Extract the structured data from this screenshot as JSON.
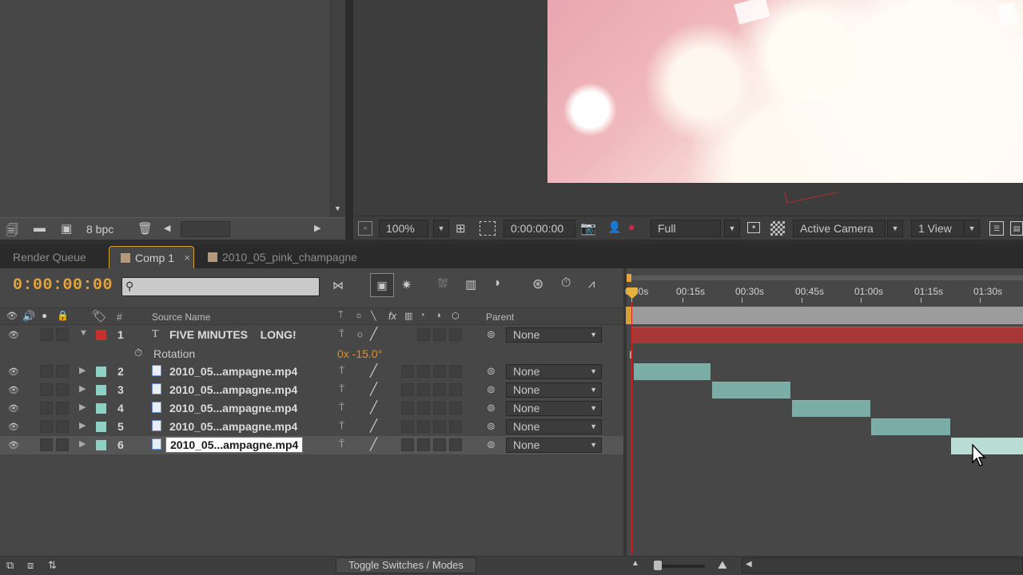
{
  "project": {
    "bpc_label": "8 bpc"
  },
  "viewer": {
    "zoom": "100%",
    "timecode": "0:00:00:00",
    "resolution": "Full",
    "camera": "Active Camera",
    "views": "1 View"
  },
  "tabs": {
    "render_queue": "Render Queue",
    "comp": "Comp 1",
    "comp_close": "×",
    "footage": "2010_05_pink_champagne"
  },
  "timeline": {
    "current_time": "0:00:00:00",
    "columns": {
      "number": "#",
      "source_name": "Source Name",
      "parent": "Parent"
    },
    "ruler_ticks": [
      "0:00s",
      "00:15s",
      "00:30s",
      "00:45s",
      "01:00s",
      "01:15s",
      "01:30s"
    ],
    "layers": [
      {
        "num": "1",
        "name": "FIVE MINUTES    LONG!",
        "type": "text",
        "label_color": "#c62f2f",
        "parent": "None"
      },
      {
        "num": "2",
        "name": "2010_05...ampagne.mp4",
        "type": "footage",
        "label_color": "#8fd0c4",
        "parent": "None"
      },
      {
        "num": "3",
        "name": "2010_05...ampagne.mp4",
        "type": "footage",
        "label_color": "#8fd0c4",
        "parent": "None"
      },
      {
        "num": "4",
        "name": "2010_05...ampagne.mp4",
        "type": "footage",
        "label_color": "#8fd0c4",
        "parent": "None"
      },
      {
        "num": "5",
        "name": "2010_05...ampagne.mp4",
        "type": "footage",
        "label_color": "#8fd0c4",
        "parent": "None"
      },
      {
        "num": "6",
        "name": "2010_05...ampagne.mp4",
        "type": "footage",
        "label_color": "#8fd0c4",
        "parent": "None"
      }
    ],
    "rotation": {
      "label": "Rotation",
      "value": "0x -15.0°"
    },
    "toggle_label": "Toggle Switches / Modes"
  },
  "colors": {
    "accent_orange": "#e3a53b",
    "text_layer_bar": "#a83838",
    "footage_bar": "#79ada5",
    "playhead": "#d82020"
  }
}
